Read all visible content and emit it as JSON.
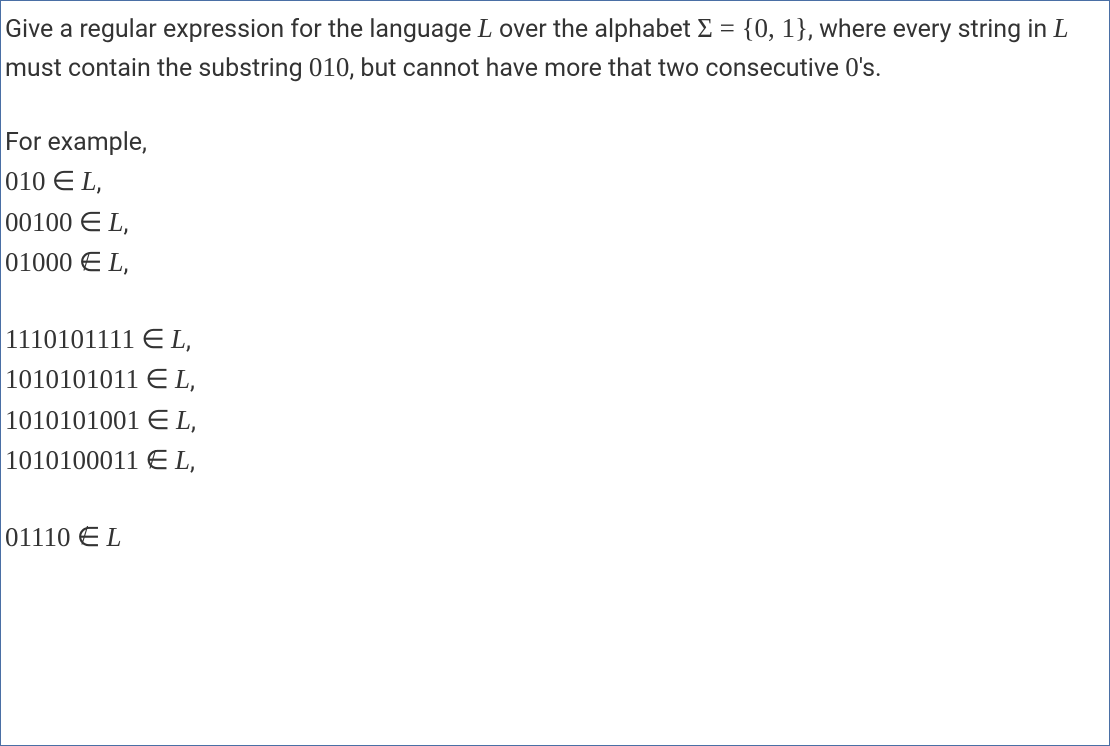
{
  "intro": {
    "text1": "Give a regular expression for the language ",
    "L": "L",
    "text2": " over the alphabet ",
    "sigma": "Σ",
    "eq": " = ",
    "set": "{0, 1}",
    "text3": ", where every string in ",
    "L2": "L",
    "text4": " must contain the substring ",
    "sub": "010",
    "text5": ", but cannot have more that two consecutive ",
    "zero": "0",
    "text6": "'s."
  },
  "forExample": "For example,",
  "in": "∈",
  "notin_base": "∈",
  "notin_slash": "/",
  "Lvar": "L",
  "comma": ",",
  "ex1": "010",
  "ex2": "00100",
  "ex3": "01000",
  "ex4": "1110101111",
  "ex5": "1010101011",
  "ex6": "1010101001",
  "ex7": "1010100011",
  "ex8": "01110"
}
